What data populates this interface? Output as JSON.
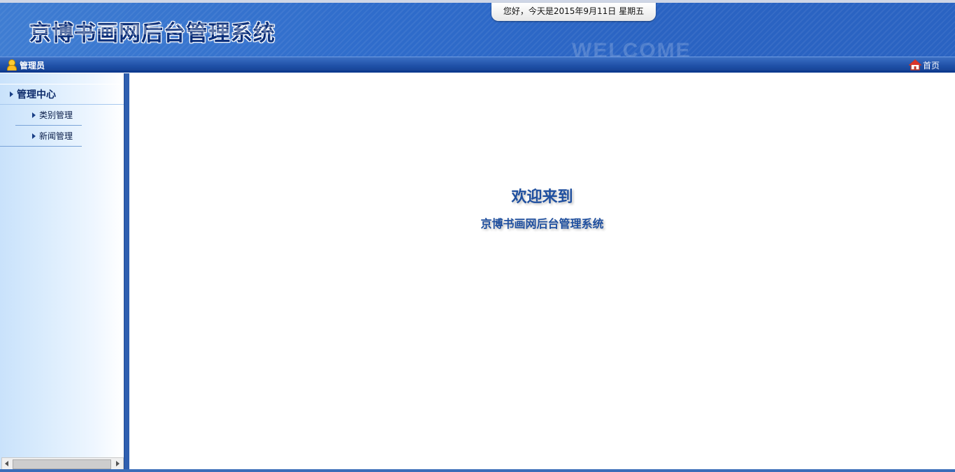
{
  "header": {
    "title": "京博书画网后台管理系统",
    "date_text": "您好，今天是2015年9月11日 星期五",
    "watermark": "WELCOME"
  },
  "toolbar": {
    "user_label": "管理员",
    "home_label": "首页"
  },
  "sidebar": {
    "group_label": "管理中心",
    "items": [
      {
        "label": "类别管理"
      },
      {
        "label": "新闻管理"
      }
    ]
  },
  "main": {
    "welcome_line1": "欢迎来到",
    "welcome_line2": "京博书画网后台管理系统"
  },
  "colors": {
    "header_blue": "#2f6ccb",
    "toolbar_blue": "#1d4ea5",
    "text_blue": "#1f4f9f"
  }
}
